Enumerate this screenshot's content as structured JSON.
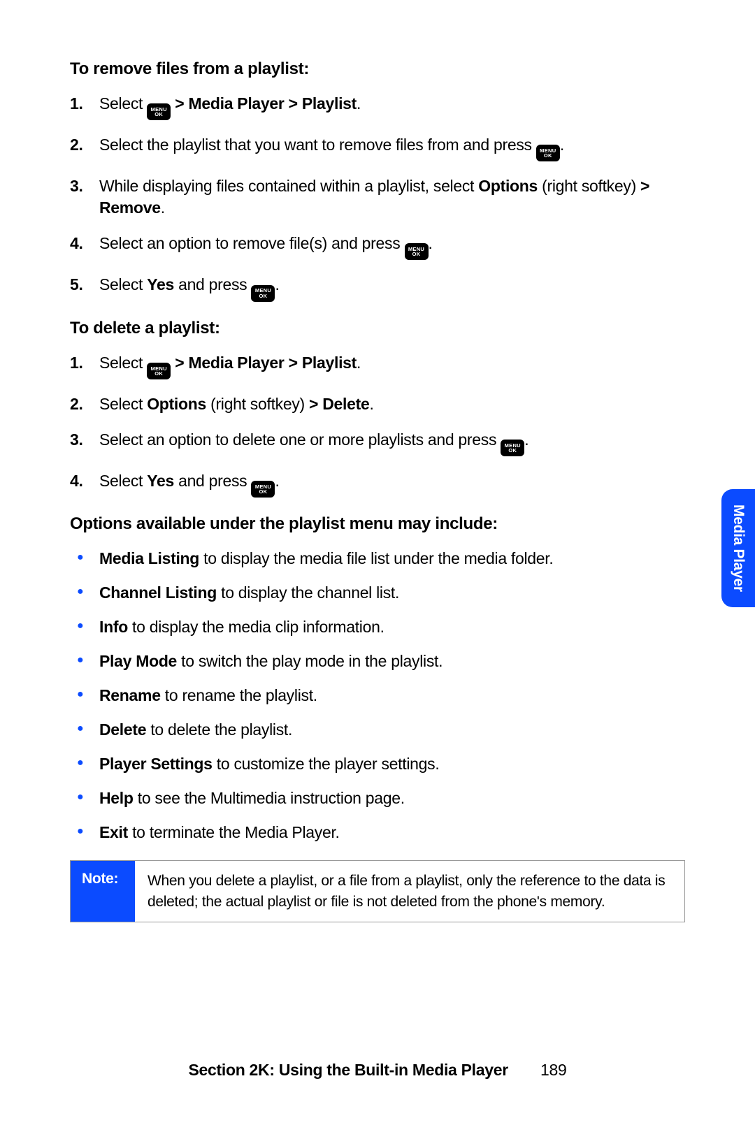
{
  "key": {
    "line1": "MENU",
    "line2": "OK"
  },
  "remove": {
    "heading": "To remove files from a playlist:",
    "steps": {
      "s1a": "Select ",
      "s1b": " > Media Player > Playlist",
      "s1c": ".",
      "s2a": "Select the playlist that you want to remove files from and press ",
      "s2b": ".",
      "s3a": "While displaying files contained within a playlist, select ",
      "s3b": "Options",
      "s3c": " (right softkey) ",
      "s3d": "> Remove",
      "s3e": ".",
      "s4a": "Select an option to remove file(s) and press ",
      "s4b": ".",
      "s5a": "Select ",
      "s5b": "Yes",
      "s5c": " and press ",
      "s5d": "."
    }
  },
  "delete": {
    "heading": "To delete a playlist:",
    "steps": {
      "s1a": "Select ",
      "s1b": " > Media Player > Playlist",
      "s1c": ".",
      "s2a": "Select ",
      "s2b": "Options",
      "s2c": " (right softkey) ",
      "s2d": "> Delete",
      "s2e": ".",
      "s3a": "Select an option to delete one or more playlists and press ",
      "s3b": ".",
      "s4a": "Select ",
      "s4b": "Yes",
      "s4c": " and press ",
      "s4d": "."
    }
  },
  "options": {
    "heading": "Options available under the playlist menu may include:",
    "items": [
      {
        "term": "Media Listing",
        "desc": " to display the media file list under the media folder."
      },
      {
        "term": "Channel Listing",
        "desc": " to display the channel list."
      },
      {
        "term": "Info",
        "desc": " to display the media clip information."
      },
      {
        "term": "Play Mode",
        "desc": " to switch the play mode in the playlist."
      },
      {
        "term": "Rename",
        "desc": " to rename the playlist."
      },
      {
        "term": "Delete",
        "desc": " to delete the playlist."
      },
      {
        "term": "Player Settings",
        "desc": " to customize the player settings."
      },
      {
        "term": "Help",
        "desc": " to see the Multimedia instruction page."
      },
      {
        "term": "Exit",
        "desc": " to terminate the Media Player."
      }
    ]
  },
  "note": {
    "label": "Note:",
    "body": "When you delete a playlist, or a file from a playlist, only the reference to the data is deleted; the actual playlist or file is not deleted from the phone's memory."
  },
  "sideTab": "Media Player",
  "footer": {
    "title": "Section 2K: Using the Built-in Media Player",
    "page": "189"
  }
}
